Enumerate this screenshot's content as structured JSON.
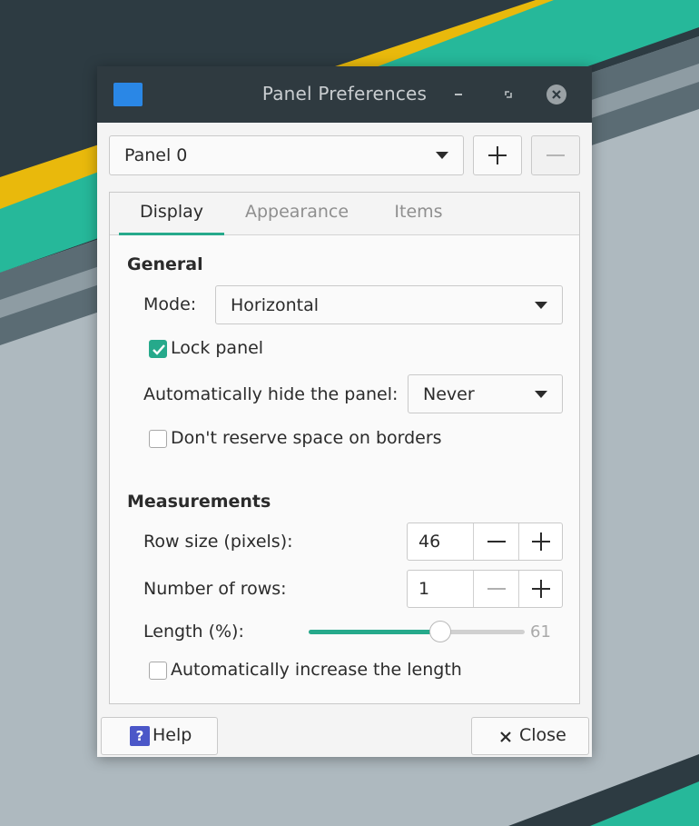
{
  "window": {
    "title": "Panel Preferences",
    "controls": [
      "minimize-icon",
      "maximize-icon",
      "close-icon"
    ]
  },
  "panel_selector": {
    "selected": "Panel 0",
    "add_icon": "plus-icon",
    "remove_icon": "minus-icon"
  },
  "tabs": [
    {
      "label": "Display",
      "active": true
    },
    {
      "label": "Appearance",
      "active": false
    },
    {
      "label": "Items",
      "active": false
    }
  ],
  "general": {
    "heading": "General",
    "mode_label": "Mode:",
    "mode_value": "Horizontal",
    "lock_panel_label": "Lock panel",
    "lock_panel_checked": true,
    "autohide_label": "Automatically hide the panel:",
    "autohide_value": "Never",
    "no_reserve_label": "Don't reserve space on borders",
    "no_reserve_checked": false
  },
  "measurements": {
    "heading": "Measurements",
    "row_size_label": "Row size (pixels):",
    "row_size_value": "46",
    "num_rows_label": "Number of rows:",
    "num_rows_value": "1",
    "length_label": "Length (%):",
    "length_value": "61",
    "length_fraction": 0.61,
    "auto_length_label": "Automatically increase the length",
    "auto_length_checked": false
  },
  "buttons": {
    "help_label": "Help",
    "close_label": "Close"
  },
  "colors": {
    "accent": "#26a98b",
    "titlebar": "#2f3a40",
    "app_icon": "#2a87e6",
    "help_icon": "#4b57c8"
  }
}
